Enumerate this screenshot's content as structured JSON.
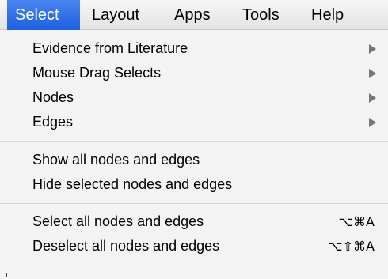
{
  "menubar": {
    "items": [
      {
        "label": "Select",
        "active": true
      },
      {
        "label": "Layout"
      },
      {
        "label": "Apps"
      },
      {
        "label": "Tools"
      },
      {
        "label": "Help"
      }
    ]
  },
  "menu": {
    "group1": [
      {
        "label": "Evidence from Literature",
        "submenu": true
      },
      {
        "label": "Mouse Drag Selects",
        "submenu": true
      },
      {
        "label": "Nodes",
        "submenu": true
      },
      {
        "label": "Edges",
        "submenu": true
      }
    ],
    "group2": [
      {
        "label": "Show all nodes and edges"
      },
      {
        "label": "Hide selected nodes and edges"
      }
    ],
    "group3": [
      {
        "label": "Select all nodes and edges",
        "shortcut": "⌥⌘A"
      },
      {
        "label": "Deselect all nodes and edges",
        "shortcut": "⌥⇧⌘A"
      }
    ]
  },
  "colors": {
    "active_menu_bg": "#2a6cf0",
    "menu_bg": "#f3f3f3"
  }
}
